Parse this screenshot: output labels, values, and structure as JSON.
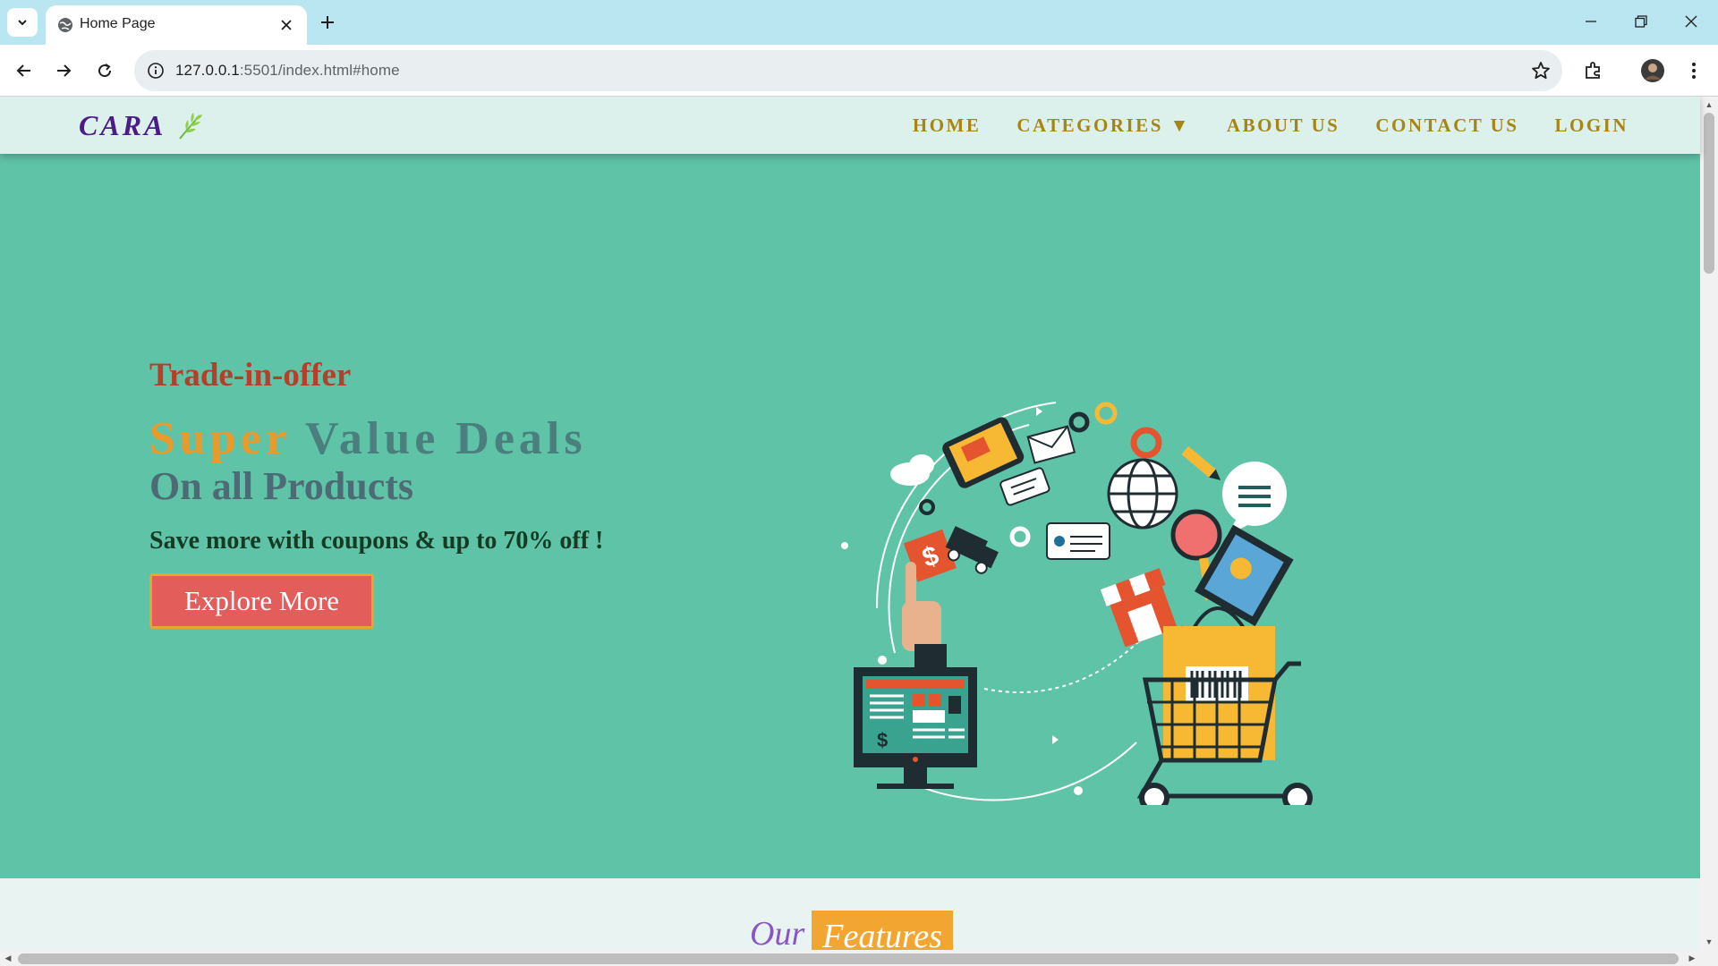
{
  "browser": {
    "tab_title": "Home Page",
    "url_host": "127.0.0.1",
    "url_rest": ":5501/index.html#home"
  },
  "site": {
    "brand": "CARA",
    "nav": {
      "home": "HOME",
      "categories": "CATEGORIES ▼",
      "about": "ABOUT US",
      "contact": "CONTACT US",
      "login": "LOGIN"
    }
  },
  "hero": {
    "trade": "Trade-in-offer",
    "deals_word1": "Super",
    "deals_word2": "Value Deals",
    "products": "On all Products",
    "save": "Save more with coupons & up to 70% off !",
    "cta": "Explore More"
  },
  "features": {
    "title_part1": "Our",
    "title_part2": "Features"
  },
  "colors": {
    "hero_bg": "#5fc3a8",
    "nav_bg": "#dcf0ec",
    "nav_link": "#a78512",
    "brand": "#4b1c86",
    "cta_bg": "#e35d5b"
  }
}
